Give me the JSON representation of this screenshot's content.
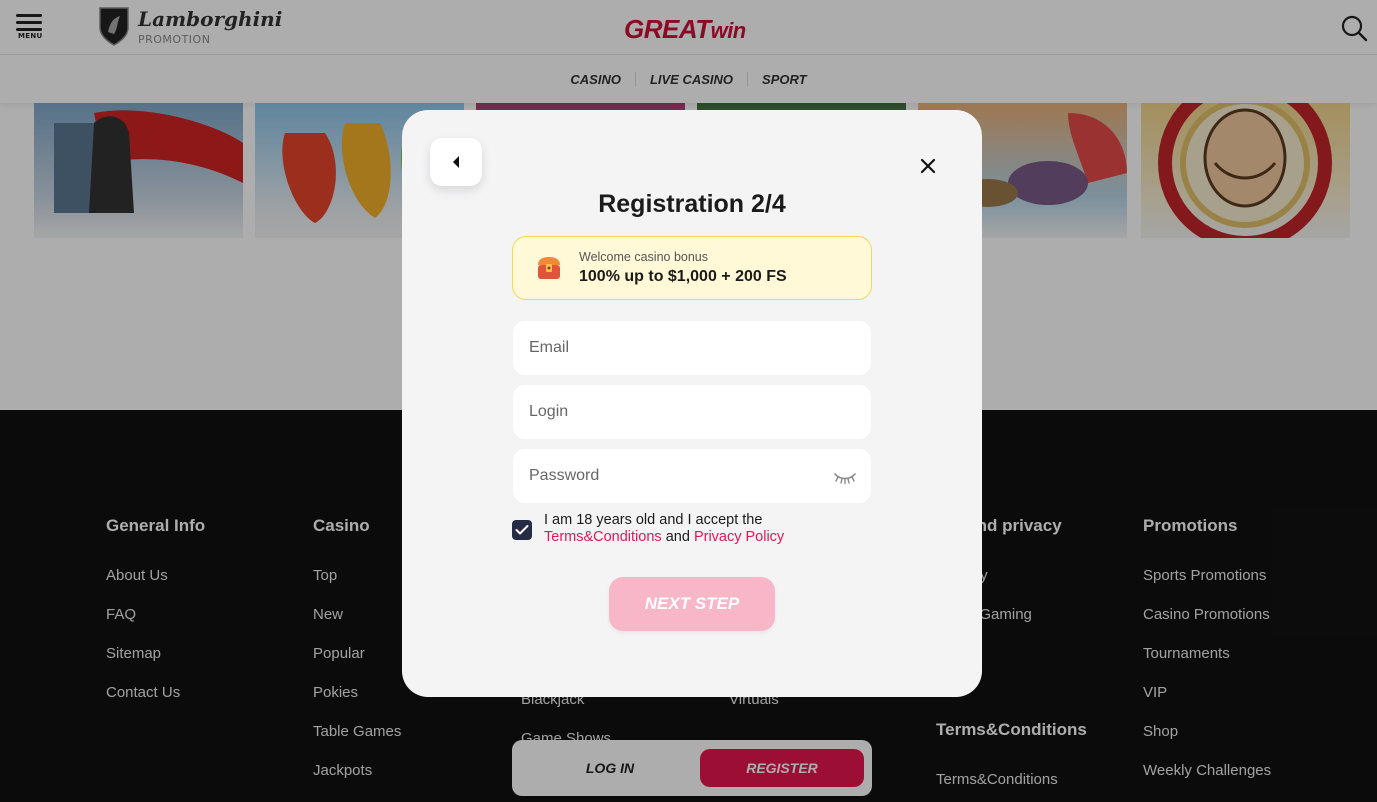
{
  "header": {
    "menu_label": "MENU",
    "partner_name": "Lamborghini",
    "partner_subtitle": "PROMOTION",
    "brand_main": "GREAT",
    "brand_suffix": "win"
  },
  "subnav": [
    "CASINO",
    "LIVE CASINO",
    "SPORT"
  ],
  "footer": {
    "columns": [
      {
        "title": "General Info",
        "links": [
          "About Us",
          "FAQ",
          "Sitemap",
          "Contact Us"
        ]
      },
      {
        "title": "Casino",
        "links": [
          "Top",
          "New",
          "Popular",
          "Pokies",
          "Table Games",
          "Jackpots"
        ]
      },
      {
        "title": "",
        "links": [
          "",
          "",
          "",
          "Blackjack",
          "Game Shows"
        ]
      },
      {
        "title": "",
        "links": [
          "",
          "",
          "",
          "Virtuals"
        ]
      },
      {
        "title": "rity and privacy",
        "links": [
          "y Policy",
          "nsible Gaming"
        ]
      },
      {
        "title": "Promotions",
        "links": [
          "Sports Promotions",
          "Casino Promotions",
          "Tournaments",
          "VIP",
          "Shop",
          "Weekly Challenges"
        ]
      }
    ],
    "terms_title": "Terms&Conditions",
    "terms_link": "Terms&Conditions"
  },
  "auth_bar": {
    "login_label": "LOG IN",
    "register_label": "REGISTER"
  },
  "modal": {
    "title": "Registration 2/4",
    "bonus": {
      "small": "Welcome casino bonus",
      "big": "100% up to $1,000 + 200 FS"
    },
    "email_placeholder": "Email",
    "login_placeholder": "Login",
    "password_placeholder": "Password",
    "consent": {
      "text_before": "I am 18 years old and I accept the",
      "terms_link": "Terms&Conditions",
      "and": "and",
      "privacy_link": "Privacy Policy"
    },
    "checkbox_checked": true,
    "next_label": "NEXT STEP"
  },
  "colors": {
    "brand_red": "#d0103a",
    "link_pink": "#e4175a",
    "register_pink": "#e8164f",
    "next_disabled": "#f7b7c8",
    "checkbox_navy": "#262c45",
    "bonus_bg": "#fff9d8"
  },
  "icons": {
    "menu": "hamburger-icon",
    "search": "search-icon",
    "back": "back-arrow-icon",
    "close": "close-icon",
    "bonus": "gift-chest-icon",
    "eye": "eye-closed-icon",
    "check": "check-icon"
  }
}
